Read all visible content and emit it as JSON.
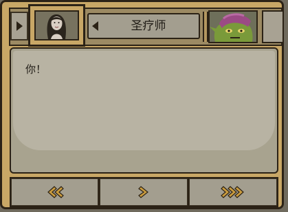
{
  "speaker": {
    "name": "圣疗师",
    "active_portrait_icon": "long-haired-woman-portrait-icon",
    "next_portrait_icon": "goblin-with-purple-hat-portrait-icon"
  },
  "dialogue": {
    "text": "你！"
  },
  "navigation": {
    "buttons": [
      {
        "icon": "rewind-double-chevron-left-icon"
      },
      {
        "icon": "next-chevron-right-icon"
      },
      {
        "icon": "fast-forward-double-chevron-right-icon"
      }
    ]
  },
  "colors": {
    "frame": "#c8a766",
    "outline": "#2b2216",
    "panel": "#b8b3a3",
    "arrow_accent": "#c99b3e"
  }
}
